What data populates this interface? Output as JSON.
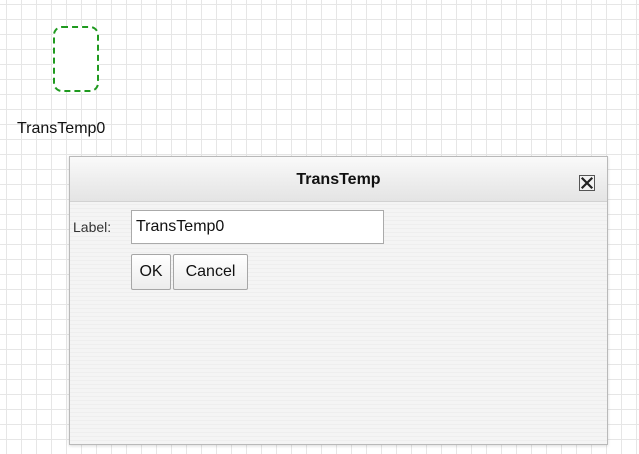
{
  "canvas": {
    "shape_label": "TransTemp0"
  },
  "dialog": {
    "title": "TransTemp",
    "label_text": "Label:",
    "label_value": "TransTemp0",
    "ok_label": "OK",
    "cancel_label": "Cancel",
    "close_icon": "close-x-icon"
  },
  "colors": {
    "shape_border": "#1f9a1f",
    "grid": "#e6e6e6"
  }
}
